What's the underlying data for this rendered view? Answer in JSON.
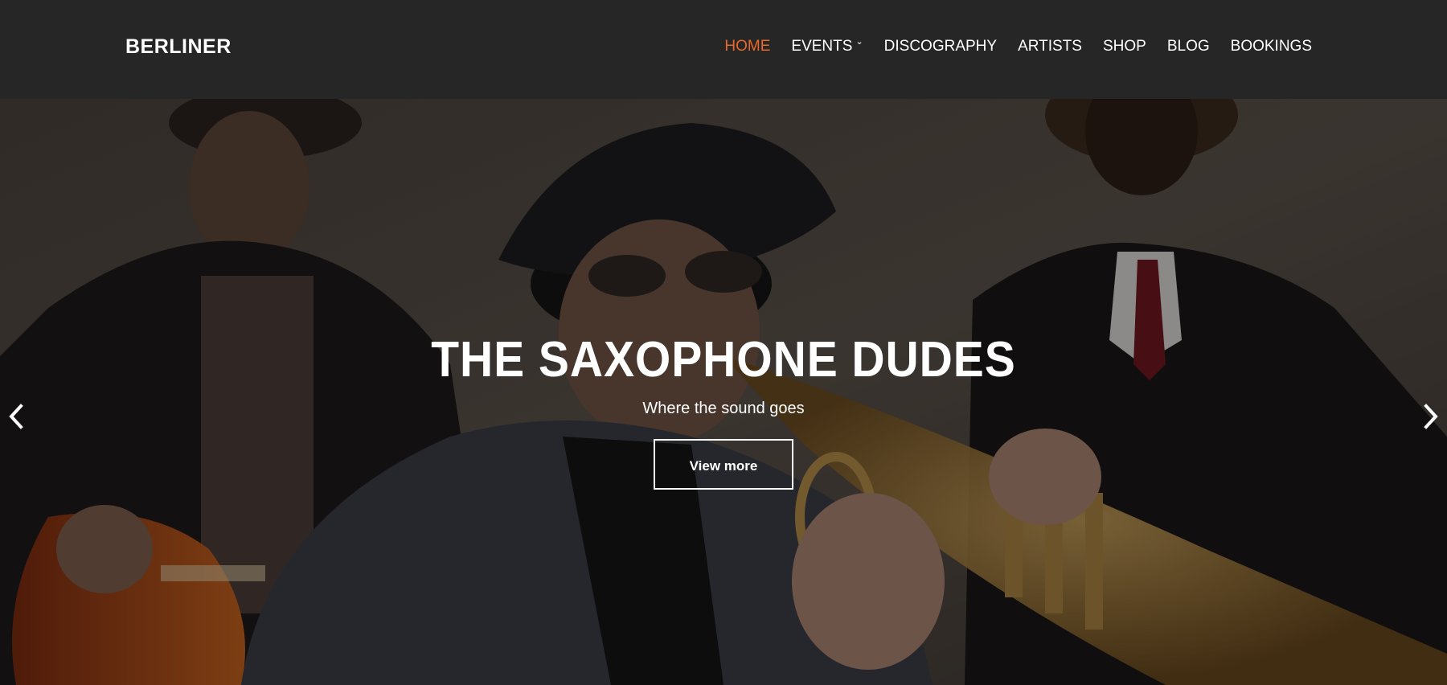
{
  "header": {
    "logo": "BERLINER",
    "nav": [
      {
        "label": "HOME",
        "active": true
      },
      {
        "label": "EVENTS",
        "has_dropdown": true
      },
      {
        "label": "DISCOGRAPHY"
      },
      {
        "label": "ARTISTS"
      },
      {
        "label": "SHOP"
      },
      {
        "label": "BLOG"
      },
      {
        "label": "BOOKINGS"
      }
    ]
  },
  "hero": {
    "title": "THE SAXOPHONE DUDES",
    "subtitle": "Where the sound goes",
    "button_label": "View more",
    "prev_icon": "chevron-left-icon",
    "next_icon": "chevron-right-icon"
  },
  "colors": {
    "header_bg": "#262626",
    "accent": "#e8692a",
    "text": "#ffffff"
  }
}
